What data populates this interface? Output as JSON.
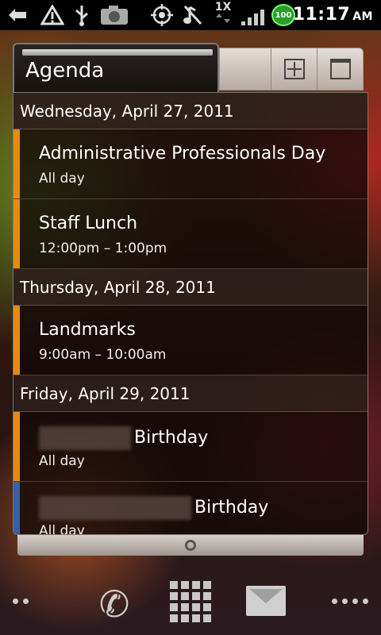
{
  "statusbar": {
    "time": "11:17",
    "ampm": "AM",
    "battery": "100",
    "network_label": "1X"
  },
  "widget": {
    "title": "Agenda",
    "days": [
      {
        "label": "Wednesday, April 27, 2011",
        "events": [
          {
            "title": "Administrative Professionals Day",
            "time": "All day",
            "color": "#e88a12"
          },
          {
            "title": "Staff Lunch",
            "time": "12:00pm – 1:00pm",
            "color": "#e88a12"
          }
        ]
      },
      {
        "label": "Thursday, April 28, 2011",
        "events": [
          {
            "title": "Landmarks",
            "time": "9:00am – 10:00am",
            "color": "#e88a12"
          }
        ]
      },
      {
        "label": "Friday, April 29, 2011",
        "events": [
          {
            "title": "Birthday",
            "time": "All day",
            "color": "#e88a12"
          },
          {
            "title": "Birthday",
            "time": "All day",
            "color": "#3a5fa8"
          }
        ]
      }
    ]
  },
  "icons": {
    "add": "add-event-icon",
    "calendar": "calendar-icon",
    "phone": "phone-icon",
    "apps": "app-grid-icon",
    "mail": "mail-icon"
  }
}
